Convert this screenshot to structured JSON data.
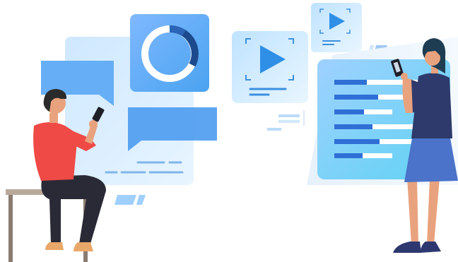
{
  "illustration": {
    "palette": {
      "panel_light": "#dcefff",
      "panel_blue": "#5aa6f2",
      "chat_blue": "#4b9bef",
      "donut_ring": "#ffffff",
      "donut_dark": "#1c4a8c",
      "play_blue": "#2f8fe6",
      "bar_dark": "#2f6fd6",
      "bar_light": "#ffffff",
      "man_shirt": "#f04a46",
      "man_pants": "#2a2a36",
      "man_hair": "#2b2b2b",
      "skin": "#e9a27e",
      "shoe": "#e8a86a",
      "stool": "#b8a99a",
      "woman_top": "#2d3a6b",
      "woman_skirt": "#4a73c9",
      "woman_hair": "#1e3d52",
      "woman_shoe": "#2e3870"
    },
    "icons": [
      "donut-chart-icon",
      "play-icon",
      "play-icon-small",
      "phone-icon",
      "chat-bubble-icon"
    ]
  }
}
